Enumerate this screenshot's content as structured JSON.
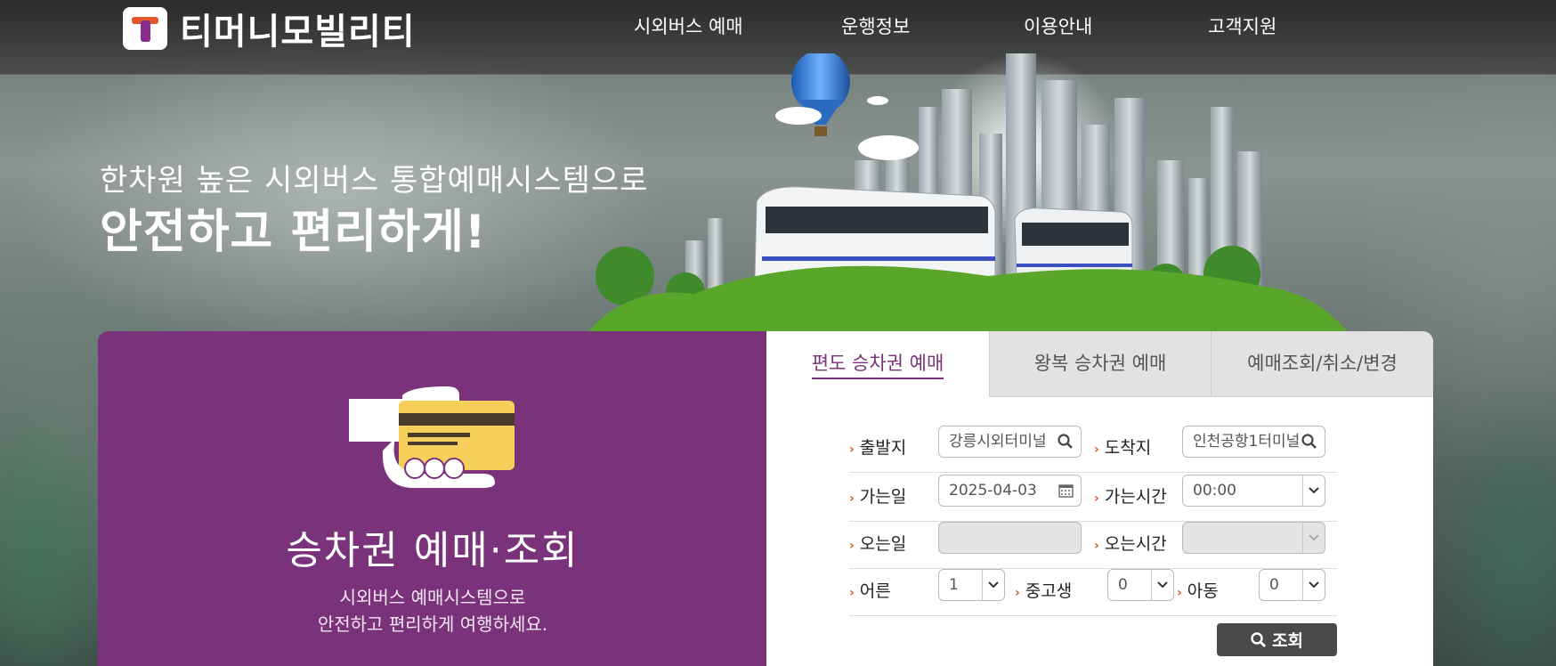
{
  "header": {
    "logo_text": "티머니모빌리티",
    "nav": [
      "시외버스 예매",
      "운행정보",
      "이용안내",
      "고객지원"
    ]
  },
  "hero": {
    "subtitle": "한차원 높은 시외버스 통합예매시스템으로",
    "title": "안전하고 편리하게!"
  },
  "promo": {
    "icon": "card-payment-icon",
    "title": "승차권 예매·조회",
    "desc_line1": "시외버스 예매시스템으로",
    "desc_line2": "안전하고 편리하게 여행하세요."
  },
  "tabs": [
    {
      "label": "편도 승차권 예매",
      "active": true
    },
    {
      "label": "왕복 승차권 예매",
      "active": false
    },
    {
      "label": "예매조회/취소/변경",
      "active": false
    }
  ],
  "form": {
    "departure_label": "출발지",
    "departure_value": "강릉시외터미널",
    "arrival_label": "도착지",
    "arrival_value": "인천공항1터미널",
    "go_date_label": "가는일",
    "go_date_value": "2025-04-03",
    "go_time_label": "가는시간",
    "go_time_value": "00:00",
    "return_date_label": "오는일",
    "return_date_value": "",
    "return_time_label": "오는시간",
    "return_time_value": "",
    "adult_label": "어른",
    "adult_value": "1",
    "youth_label": "중고생",
    "youth_value": "0",
    "child_label": "아동",
    "child_value": "0",
    "search_button": "조회"
  },
  "colors": {
    "brand_purple": "#7a337b",
    "accent_orange": "#d55a1a",
    "button_dark": "#4a4a4a"
  }
}
